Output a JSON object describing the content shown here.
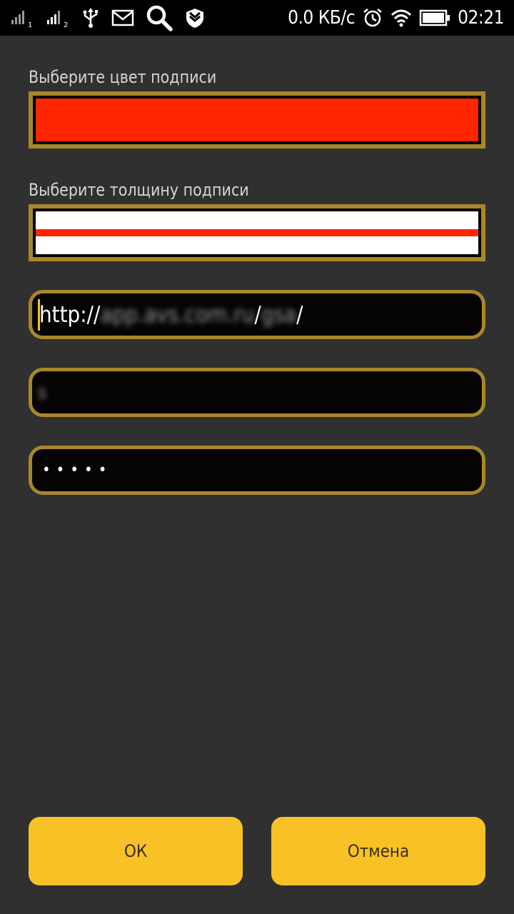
{
  "status_bar": {
    "network_speed": "0.0 КБ/с",
    "time": "02:21",
    "sim1": "1",
    "sim2": "2",
    "icons": [
      "signal-sim1-icon",
      "signal-sim2-icon",
      "usb-icon",
      "mail-icon",
      "search-icon",
      "shield-icon",
      "alarm-icon",
      "wifi-icon",
      "battery-icon"
    ]
  },
  "form": {
    "color_label": "Выберите цвет подписи",
    "selected_color": "#ff2600",
    "thickness_label": "Выберите толщину подписи",
    "line_color": "#ff2600",
    "url_prefix": "http://",
    "url_host_blurred": "app.avs.com.ru",
    "url_sep": "/",
    "url_path_blurred": "gsa",
    "url_trailing": "/",
    "login_blurred": "s",
    "password_masked": "•••••"
  },
  "buttons": {
    "ok": "ОК",
    "cancel": "Отмена"
  },
  "colors": {
    "accent": "#f8c227",
    "frame": "#a8862b",
    "background": "#303030"
  }
}
